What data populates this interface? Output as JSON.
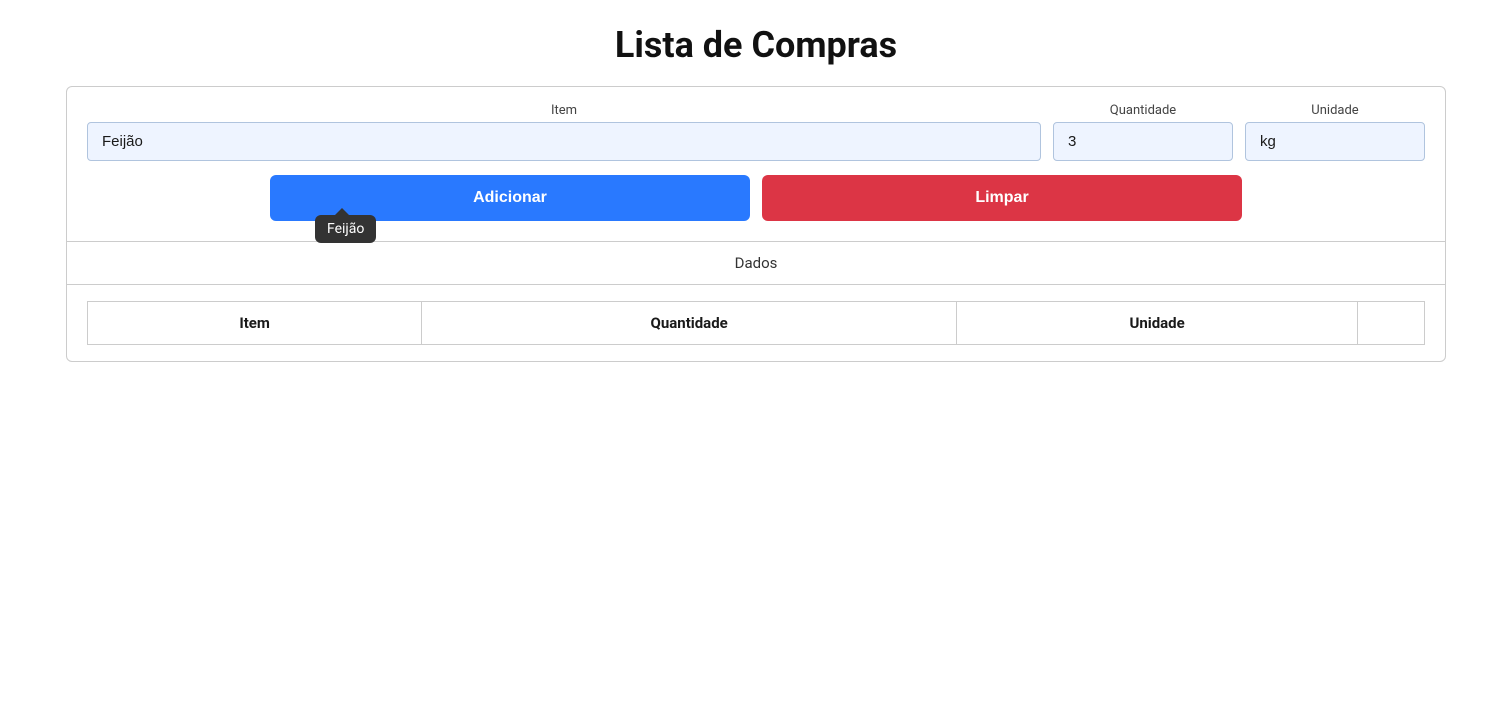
{
  "page": {
    "title": "Lista de Compras"
  },
  "form": {
    "item_label": "Item",
    "item_value": "Feijão",
    "item_placeholder": "",
    "quantity_label": "Quantidade",
    "quantity_value": "3",
    "unit_label": "Unidade",
    "unit_value": "kg",
    "add_button": "Adicionar",
    "clear_button": "Limpar"
  },
  "autocomplete": {
    "suggestion": "Feijão"
  },
  "dados_section": {
    "label": "Dados"
  },
  "table": {
    "headers": {
      "item": "Item",
      "quantity": "Quantidade",
      "unit": "Unidade",
      "actions": ""
    },
    "rows": []
  }
}
